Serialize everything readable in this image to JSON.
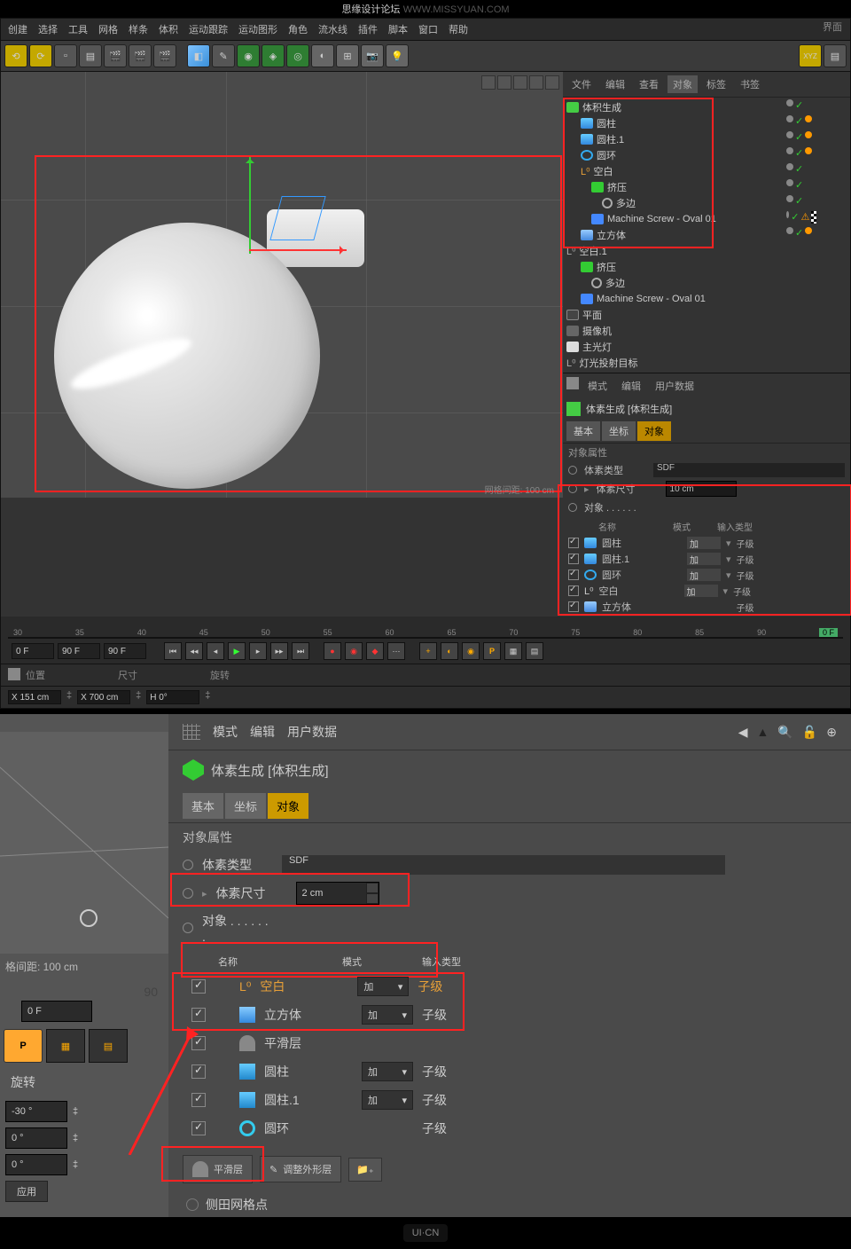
{
  "watermark": {
    "text": "思缘设计论坛",
    "url": "WWW.MISSYUAN.COM"
  },
  "menubar": [
    "创建",
    "选择",
    "工具",
    "网格",
    "样条",
    "体积",
    "运动跟踪",
    "运动图形",
    "角色",
    "流水线",
    "插件",
    "脚本",
    "窗口",
    "帮助"
  ],
  "toplabel": "界面",
  "viewport": {
    "grid_label": "网格间距: 100 cm"
  },
  "side_tabs": [
    "文件",
    "编辑",
    "查看",
    "对象",
    "标签",
    "书签"
  ],
  "hierarchy": [
    {
      "name": "体积生成",
      "type": "vox",
      "orange": true,
      "indent": 0
    },
    {
      "name": "圆柱",
      "type": "cyl",
      "orange": true,
      "indent": 1
    },
    {
      "name": "圆柱.1",
      "type": "cyl",
      "orange": true,
      "indent": 1
    },
    {
      "name": "圆环",
      "type": "tor",
      "orange": true,
      "indent": 1
    },
    {
      "name": "空白",
      "type": "null",
      "orange": true,
      "indent": 1
    },
    {
      "name": "挤压",
      "type": "ext",
      "orange": true,
      "indent": 2
    },
    {
      "name": "多边",
      "type": "poly",
      "orange": true,
      "indent": 3
    },
    {
      "name": "Machine Screw - Oval 01",
      "type": "scr",
      "orange": true,
      "indent": 2
    },
    {
      "name": "立方体",
      "type": "cube",
      "orange": true,
      "indent": 1
    },
    {
      "name": "空白.1",
      "type": "null",
      "indent": 0
    },
    {
      "name": "挤压",
      "type": "ext",
      "indent": 1
    },
    {
      "name": "多边",
      "type": "poly",
      "indent": 2
    },
    {
      "name": "Machine Screw - Oval 01",
      "type": "scr",
      "indent": 1
    },
    {
      "name": "平面",
      "type": "flr",
      "indent": 0
    },
    {
      "name": "摄像机",
      "type": "cam",
      "indent": 0
    },
    {
      "name": "主光灯",
      "type": "lgt",
      "indent": 0
    },
    {
      "name": "灯光投射目标",
      "type": "tgt",
      "indent": 0
    }
  ],
  "timeline": {
    "ticks": [
      "30",
      "35",
      "40",
      "45",
      "50",
      "55",
      "60",
      "65",
      "70",
      "75",
      "80",
      "85",
      "90"
    ],
    "frame_start": "0 F",
    "frame_cur": "90 F",
    "frame_end": "90 F",
    "frame_info": "0 F"
  },
  "coord": {
    "pos_label": "位置",
    "size_label": "尺寸",
    "rot_label": "旋转",
    "x": "X 151 cm",
    "sx": "X 700 cm",
    "h": "H 0°"
  },
  "attr": {
    "tabs": [
      "模式",
      "编辑",
      "用户数据"
    ],
    "title": "体素生成 [体积生成]",
    "btns": [
      "基本",
      "坐标",
      "对象"
    ],
    "section": "对象属性",
    "type_label": "体素类型",
    "type_val": "SDF",
    "size_label": "体素尺寸",
    "size_val": "10 cm",
    "obj_label": "对象 . . . . . .",
    "cols": [
      "名称",
      "模式",
      "输入类型"
    ],
    "rows": [
      {
        "name": "圆柱",
        "mode": "加",
        "type": "子级",
        "ico": "cyl"
      },
      {
        "name": "圆柱.1",
        "mode": "加",
        "type": "子级",
        "ico": "cyl"
      },
      {
        "name": "圆环",
        "mode": "加",
        "type": "子级",
        "ico": "tor"
      },
      {
        "name": "空白",
        "mode": "加",
        "type": "子级",
        "ico": "null"
      },
      {
        "name": "立方体",
        "mode": "",
        "type": "子级",
        "ico": "cube"
      }
    ]
  },
  "bot_left": {
    "grid_label": "格间距: 100 cm",
    "tl_end": "90",
    "frame": "0 F",
    "big_btn": "P",
    "rot_label": "旋转",
    "vals": [
      "-30 °",
      "0 °",
      "0 °"
    ],
    "apply": "应用"
  },
  "bot_attr": {
    "tabs": [
      "模式",
      "编辑",
      "用户数据"
    ],
    "title": "体素生成 [体积生成]",
    "btns": [
      "基本",
      "坐标",
      "对象"
    ],
    "section": "对象属性",
    "type_label": "体素类型",
    "type_val": "SDF",
    "size_label": "体素尺寸",
    "size_val": "2 cm",
    "obj_label": "对象 . . . . . . .",
    "cols": [
      "名称",
      "模式",
      "输入类型"
    ],
    "rows": [
      {
        "ico": "null",
        "name": "空白",
        "mode": "加",
        "type": "子级",
        "orange": true
      },
      {
        "ico": "cube",
        "name": "立方体",
        "mode": "加",
        "type": "子级"
      },
      {
        "ico": "smt",
        "name": "平滑层",
        "mode": "",
        "type": ""
      },
      {
        "ico": "cyl",
        "name": "圆柱",
        "mode": "加",
        "type": "子级"
      },
      {
        "ico": "cyl",
        "name": "圆柱.1",
        "mode": "加",
        "type": "子级"
      },
      {
        "ico": "tor",
        "name": "圆环",
        "mode": "",
        "type": "子级"
      }
    ],
    "bottom_btns": [
      "平滑层",
      "调整外形层"
    ],
    "last_label": "侧田网格点"
  },
  "footer": "UI·CN"
}
